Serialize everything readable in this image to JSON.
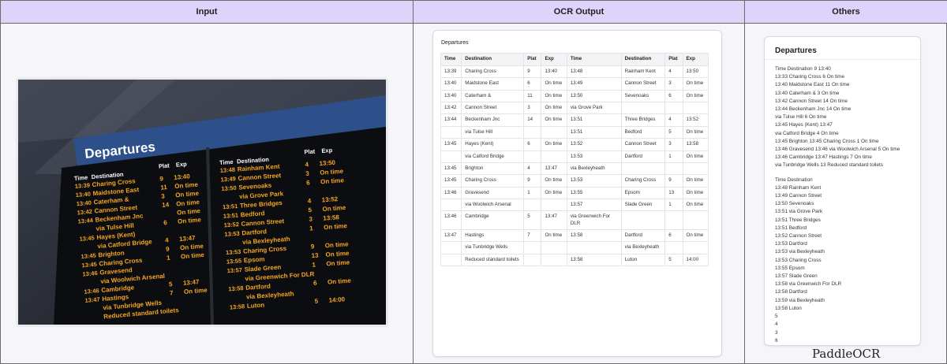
{
  "columns": {
    "input": "Input",
    "ocr": "OCR Output",
    "others": "Others"
  },
  "photo": {
    "board_title": "Departures",
    "header_time": "Time",
    "header_destination": "Destination",
    "header_plat": "Plat",
    "header_exp": "Exp",
    "left_rows": [
      {
        "time": "13:39",
        "dest": "Charing Cross",
        "plat": "9",
        "exp": "13:40"
      },
      {
        "time": "13:40",
        "dest": "Maidstone East",
        "plat": "11",
        "exp": "On time"
      },
      {
        "time": "13:40",
        "dest": "Caterham &",
        "plat": "3",
        "exp": "On time"
      },
      {
        "time": "13:42",
        "dest": "Cannon Street",
        "plat": "14",
        "exp": "On time"
      },
      {
        "time": "13:44",
        "dest": "Beckenham Jnc",
        "plat": "",
        "exp": "On time"
      },
      {
        "time": "",
        "dest": "via Tulse Hill",
        "plat": "6",
        "exp": "On time"
      },
      {
        "time": "13:45",
        "dest": "Hayes (Kent)",
        "plat": "",
        "exp": ""
      },
      {
        "time": "",
        "dest": "via Catford Bridge",
        "plat": "4",
        "exp": "13:47"
      },
      {
        "time": "13:45",
        "dest": "Brighton",
        "plat": "9",
        "exp": "On time"
      },
      {
        "time": "13:45",
        "dest": "Charing Cross",
        "plat": "1",
        "exp": "On time"
      },
      {
        "time": "13:46",
        "dest": "Gravesend",
        "plat": "",
        "exp": ""
      },
      {
        "time": "",
        "dest": "via Woolwich Arsenal",
        "plat": "",
        "exp": ""
      },
      {
        "time": "13:46",
        "dest": "Cambridge",
        "plat": "5",
        "exp": "13:47"
      },
      {
        "time": "13:47",
        "dest": "Hastings",
        "plat": "7",
        "exp": "On time"
      },
      {
        "time": "",
        "dest": "via Tunbridge Wells",
        "plat": "",
        "exp": ""
      },
      {
        "time": "",
        "dest": "Reduced standard toilets",
        "plat": "",
        "exp": ""
      }
    ],
    "right_rows": [
      {
        "time": "13:48",
        "dest": "Rainham Kent",
        "plat": "4",
        "exp": "13:50"
      },
      {
        "time": "13:49",
        "dest": "Cannon Street",
        "plat": "3",
        "exp": "On time"
      },
      {
        "time": "13:50",
        "dest": "Sevenoaks",
        "plat": "6",
        "exp": "On time"
      },
      {
        "time": "",
        "dest": "via Grove Park",
        "plat": "",
        "exp": ""
      },
      {
        "time": "13:51",
        "dest": "Three Bridges",
        "plat": "4",
        "exp": "13:52"
      },
      {
        "time": "13:51",
        "dest": "Bedford",
        "plat": "5",
        "exp": "On time"
      },
      {
        "time": "13:52",
        "dest": "Cannon Street",
        "plat": "3",
        "exp": "13:58"
      },
      {
        "time": "13:53",
        "dest": "Dartford",
        "plat": "1",
        "exp": "On time"
      },
      {
        "time": "",
        "dest": "via Bexleyheath",
        "plat": "",
        "exp": ""
      },
      {
        "time": "13:53",
        "dest": "Charing Cross",
        "plat": "9",
        "exp": "On time"
      },
      {
        "time": "13:55",
        "dest": "Epsom",
        "plat": "13",
        "exp": "On time"
      },
      {
        "time": "13:57",
        "dest": "Slade Green",
        "plat": "1",
        "exp": "On time"
      },
      {
        "time": "",
        "dest": "via Greenwich For DLR",
        "plat": "",
        "exp": ""
      },
      {
        "time": "13:58",
        "dest": "Dartford",
        "plat": "6",
        "exp": "On time"
      },
      {
        "time": "",
        "dest": "via Bexleyheath",
        "plat": "",
        "exp": ""
      },
      {
        "time": "13:58",
        "dest": "Luton",
        "plat": "5",
        "exp": "14:00"
      }
    ]
  },
  "ocr": {
    "title": "Departures",
    "headers": [
      "Time",
      "Destination",
      "Plat",
      "Exp",
      "Time",
      "Destination",
      "Plat",
      "Exp"
    ],
    "rows": [
      [
        "13:39",
        "Charing Cross",
        "9",
        "13:40",
        "13:48",
        "Rainham Kent",
        "4",
        "13:50"
      ],
      [
        "13:40",
        "Maidstone East",
        "6",
        "On time",
        "13:49",
        "Cannon Street",
        "3",
        "On time"
      ],
      [
        "13:40",
        "Caterham &",
        "11",
        "On time",
        "13:50",
        "Sevenoaks",
        "6",
        "On time"
      ],
      [
        "13:42",
        "Cannon Street",
        "3",
        "On time",
        "via Grove Park",
        "",
        "",
        ""
      ],
      [
        "13:44",
        "Beckenham Jnc",
        "14",
        "On time",
        "13:51",
        "Three Bridges",
        "4",
        "13:52"
      ],
      [
        "",
        "via Tulse Hill",
        "",
        "",
        "13:51",
        "Bedford",
        "5",
        "On time"
      ],
      [
        "13:45",
        "Hayes (Kent)",
        "6",
        "On time",
        "13:52",
        "Cannon Street",
        "3",
        "13:58"
      ],
      [
        "",
        "via Catford Bridge",
        "",
        "",
        "13:53",
        "Dartford",
        "1",
        "On time"
      ],
      [
        "13:45",
        "Brighton",
        "4",
        "13:47",
        "via Bexleyheath",
        "",
        "",
        ""
      ],
      [
        "13:45",
        "Charing Cross",
        "9",
        "On time",
        "13:53",
        "Charing Cross",
        "9",
        "On time"
      ],
      [
        "13:46",
        "Gravesend",
        "1",
        "On time",
        "13:55",
        "Epsom",
        "13",
        "On time"
      ],
      [
        "",
        "via Woolwich Arsenal",
        "",
        "",
        "13:57",
        "Slade Green",
        "1",
        "On time"
      ],
      [
        "13:46",
        "Cambridge",
        "5",
        "13:47",
        "via Greenwich For DLR",
        "",
        "",
        ""
      ],
      [
        "13:47",
        "Hastings",
        "7",
        "On time",
        "13:58",
        "Dartford",
        "6",
        "On time"
      ],
      [
        "",
        "via Tunbridge Wells",
        "",
        "",
        "",
        "via Bexleyheath",
        "",
        ""
      ],
      [
        "",
        "Reduced standard toilets",
        "",
        "",
        "13:58",
        "Luton",
        "5",
        "14:00"
      ]
    ]
  },
  "others": {
    "title": "Departures",
    "block1": [
      "Time Destination 9 13:40",
      "13:33 Charing Cross 6 On time",
      "13:40 Maidstone East 11 On time",
      "13:40 Caterham & 3 On time",
      "13:42 Cannon Street 14 On time",
      "13:44 Beckenham Jnc 14 On time",
      "via Tulse Hill 6 On time",
      "13:45 Hayes (Kent) 13:47",
      "via Catford Bridge 4 On time",
      "13:45 Brighton 13:45 Charing Cross 1 On time",
      "13:46 Gravesend 13:46 via Woolwich Arsenal 5 On time",
      "13:46 Cambridge 13:47 Hastings 7 On time",
      "via Tunbridge Wells 13 Reduced standard toilets"
    ],
    "block2": [
      "Time Destination",
      "13:48 Rainham Kent",
      "13:49 Cannon Street",
      "13:50 Sevenoaks",
      "13:51 via Grove Park",
      "13:51 Three Bridges",
      "13:51 Bedford",
      "13:52 Cannon Street",
      "13:53 Dartford",
      "13:53 via Bexleyheath",
      "13:53 Charing Cross",
      "13:55 Epsom",
      "13:57 Slade Green",
      "13:58 via Greenwich For DLR",
      "13:58 Dartford",
      "13:59 via Bexleyheath",
      "13:58 Luton",
      "5",
      "4",
      "3",
      "6"
    ]
  },
  "brand": "PaddleOCR",
  "colors": {
    "header_bg": "#ddd3fb",
    "board_text": "#f5a623",
    "board_title_bg": "#2d4f8a"
  }
}
